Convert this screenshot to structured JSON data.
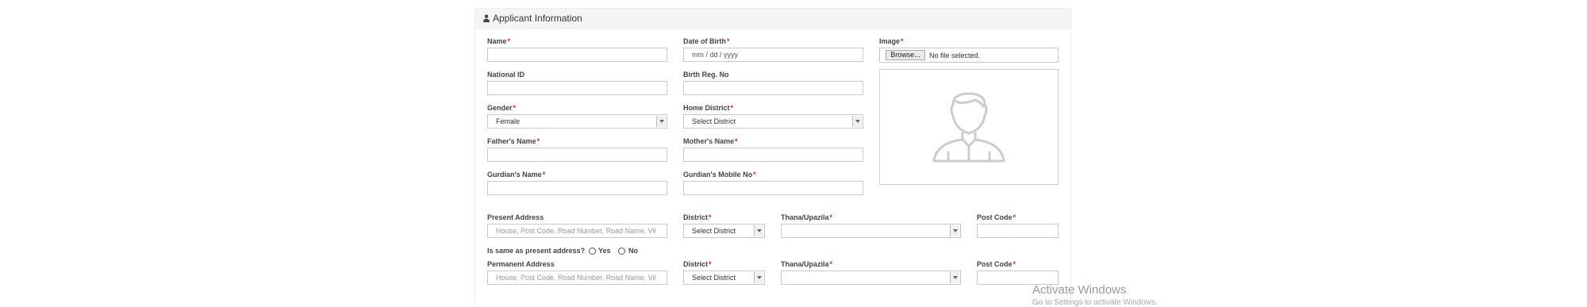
{
  "panel": {
    "title": "Applicant Information"
  },
  "fields": {
    "name": {
      "label": "Name",
      "value": ""
    },
    "dob": {
      "label": "Date of Birth",
      "value": "mm / dd / yyyy"
    },
    "image": {
      "label": "Image",
      "browse": "Browse...",
      "status": "No file selected."
    },
    "national_id": {
      "label": "National ID",
      "value": ""
    },
    "birth_reg": {
      "label": "Birth Reg. No",
      "value": ""
    },
    "gender": {
      "label": "Gender",
      "value": "Female"
    },
    "home_district": {
      "label": "Home District",
      "value": "Select District"
    },
    "father": {
      "label": "Father's Name",
      "value": ""
    },
    "mother": {
      "label": "Mother's Name",
      "value": ""
    },
    "guardian": {
      "label": "Gurdian's Name",
      "value": ""
    },
    "guardian_mobile": {
      "label": "Gurdian's Mobile No",
      "value": ""
    }
  },
  "present": {
    "label": "Present Address",
    "placeholder": "House, Post Code, Road Number, Road Name, Vil",
    "district_label": "District",
    "district_value": "Select District",
    "thana_label": "Thana/Upazila",
    "thana_value": "",
    "post_label": "Post Code",
    "post_value": ""
  },
  "same_question": {
    "label": "Is same as present address?",
    "yes": "Yes",
    "no": "No"
  },
  "permanent": {
    "label": "Permanent Address",
    "placeholder": "House, Post Code, Road Number, Road Name, Vil",
    "district_label": "District",
    "district_value": "Select District",
    "thana_label": "Thana/Upazila",
    "thana_value": "",
    "post_label": "Post Code",
    "post_value": ""
  },
  "watermark": {
    "line1": "Activate Windows",
    "line2": "Go to Settings to activate Windows."
  },
  "colors": {
    "required": "#d9232d",
    "border": "#c9c9c9",
    "header_bg": "#f5f5f5"
  }
}
